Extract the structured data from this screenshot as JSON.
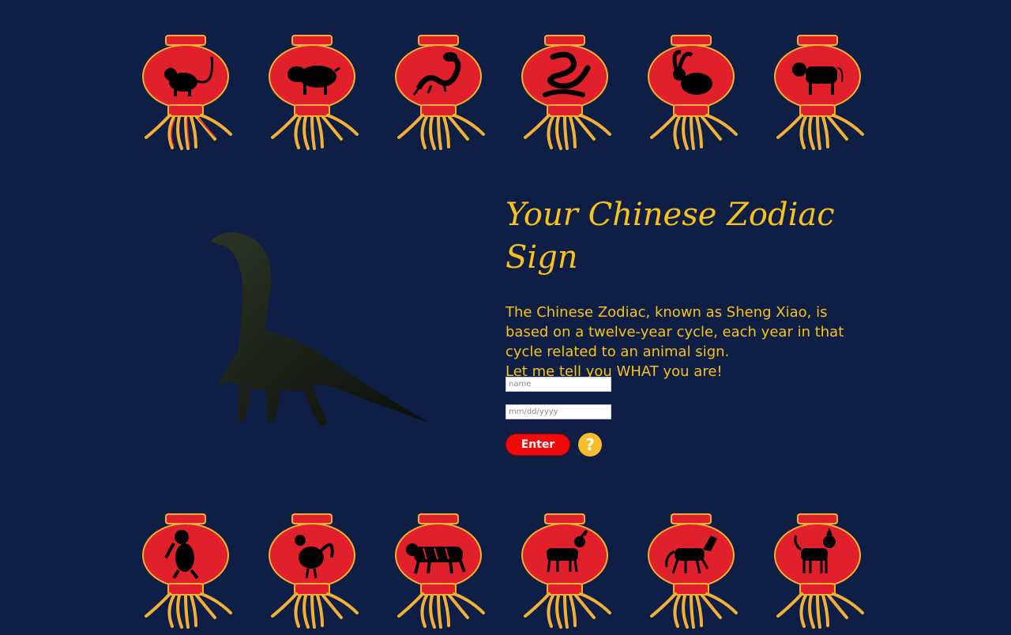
{
  "header": {
    "lanterns": [
      {
        "animal": "rat-icon"
      },
      {
        "animal": "pig-icon"
      },
      {
        "animal": "dragon-icon"
      },
      {
        "animal": "snake-icon"
      },
      {
        "animal": "rabbit-icon"
      },
      {
        "animal": "ox-icon"
      }
    ]
  },
  "footer": {
    "lanterns": [
      {
        "animal": "monkey-icon"
      },
      {
        "animal": "rooster-icon"
      },
      {
        "animal": "tiger-icon"
      },
      {
        "animal": "goat-icon"
      },
      {
        "animal": "horse-icon"
      },
      {
        "animal": "dog-icon"
      }
    ]
  },
  "hero": {
    "image": "loch-ness-monster-icon"
  },
  "main": {
    "title": "Your Chinese Zodiac Sign",
    "description_line1": "The Chinese Zodiac, known as Sheng Xiao, is based on a twelve-year cycle, each year in that cycle related to an animal sign.",
    "description_line2": "Let me tell you WHAT you are!"
  },
  "form": {
    "name_placeholder": "name",
    "date_placeholder": "mm/dd/yyyy",
    "enter_label": "Enter",
    "help_label": "?"
  },
  "colors": {
    "background": "#0f1e45",
    "accent": "#f7c21a",
    "lantern_red": "#e0202a",
    "button_red": "#f20a0a",
    "help_yellow": "#f7bd2a"
  }
}
